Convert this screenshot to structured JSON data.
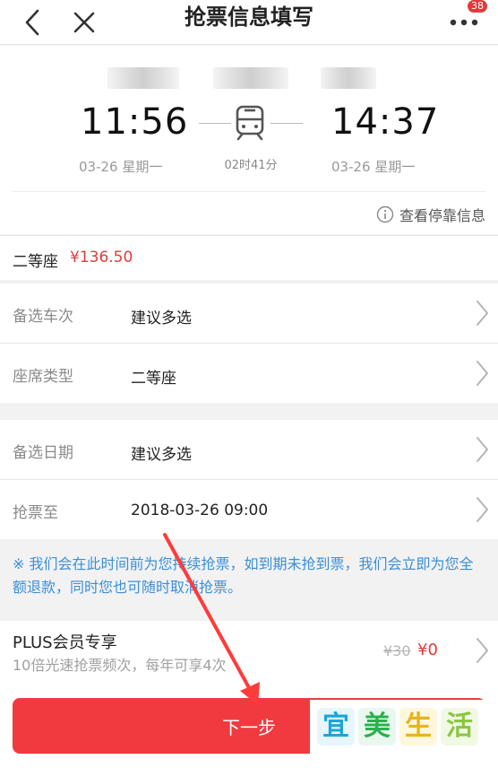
{
  "header": {
    "title": "抢票信息填写",
    "badge_count": "38",
    "icons": [
      "chevron-left-icon",
      "close-icon",
      "more-icon"
    ]
  },
  "train": {
    "depart_time": "11:56",
    "arrive_time": "14:37",
    "duration": "02时41分",
    "depart_date": "03-26 星期一",
    "arrive_date": "03-26 星期一",
    "stop_info_label": "查看停靠信息"
  },
  "seat": {
    "label": "二等座",
    "price": "¥136.50"
  },
  "form": {
    "rows": [
      {
        "key": "备选车次",
        "value": "建议多选"
      },
      {
        "key": "座席类型",
        "value": "二等座"
      },
      {
        "key": "备选日期",
        "value": "建议多选"
      },
      {
        "key": "抢票至",
        "value": "2018-03-26 09:00"
      }
    ]
  },
  "note": {
    "text": "※ 我们会在此时间前为您持续抢票，如到期未抢到票，我们会立即为您全额退款，同时您也可随时取消抢票。"
  },
  "plus": {
    "title": "PLUS会员专享",
    "subtitle": "10倍光速抢票频次，每年可享4次",
    "original_price": "¥30",
    "current_price": "¥0"
  },
  "footer": {
    "next_label": "下一步"
  },
  "watermark": {
    "chars": [
      "宜",
      "美",
      "生",
      "活"
    ]
  },
  "colors": {
    "accent": "#f03a3f",
    "price_red": "#e23b3b",
    "note_blue": "#3a8fd8"
  }
}
